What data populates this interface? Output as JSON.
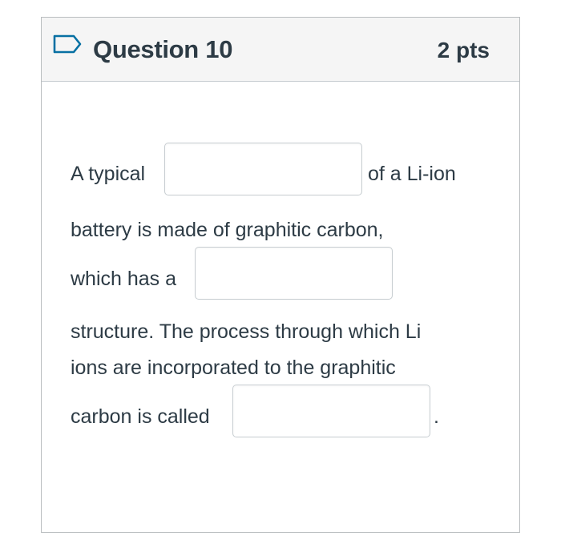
{
  "question": {
    "title": "Question 10",
    "points": "2 pts",
    "flag_icon": "flag-outline-icon"
  },
  "prompt": {
    "line1_before": "A typical",
    "line1_after": "of a Li-ion",
    "line2": "battery is made of graphitic carbon,",
    "line3_before": "which has a",
    "line4": "structure. The process through which Li",
    "line5": "ions are incorporated to the graphitic",
    "line6_before": "carbon is called",
    "line6_after": "."
  },
  "blanks": [
    {
      "value": ""
    },
    {
      "value": ""
    },
    {
      "value": ""
    }
  ],
  "colors": {
    "text": "#2d3b45",
    "header_bg": "#f5f5f5",
    "border": "#b9bdbf",
    "flag_stroke": "#0770a3"
  }
}
